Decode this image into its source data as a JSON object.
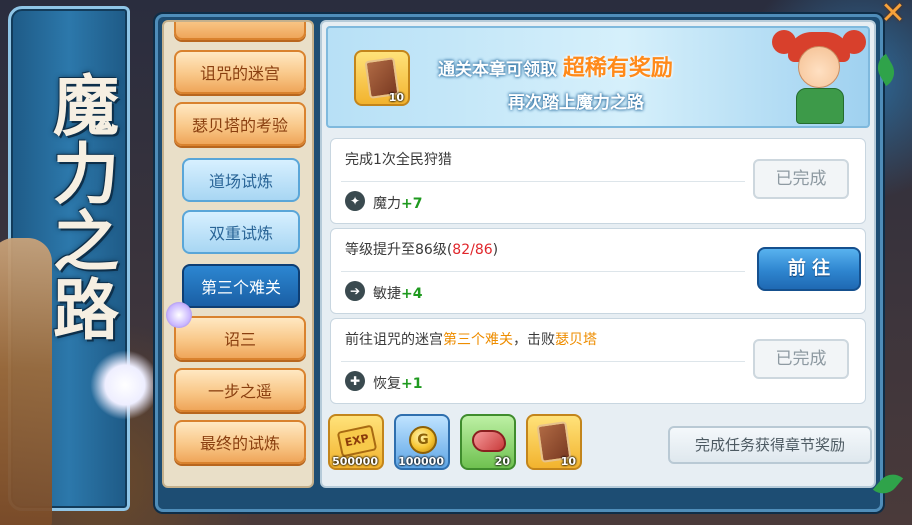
{
  "banner": {
    "title": "魔力之路"
  },
  "window": {
    "close_glyph": "✕",
    "close_icon": "close-icon"
  },
  "nav": {
    "items": [
      {
        "label": "诅咒的迷宫",
        "style": "orange"
      },
      {
        "label": "瑟贝塔的考验",
        "style": "orange"
      },
      {
        "label": "道场试炼",
        "style": "blue"
      },
      {
        "label": "双重试炼",
        "style": "blue"
      },
      {
        "label": "第三个难关",
        "style": "blue-active"
      },
      {
        "label": "诏三",
        "style": "orange"
      },
      {
        "label": "一步之遥",
        "style": "orange"
      },
      {
        "label": "最终的试炼",
        "style": "orange"
      }
    ]
  },
  "promo": {
    "line1_prefix": "通关本章可领取",
    "line1_highlight": "超稀有奖励",
    "line2": "再次踏上魔力之路",
    "item": {
      "icon": "card-icon",
      "qty": "10"
    }
  },
  "tasks": [
    {
      "title": "完成1次全民狩猎",
      "reward_icon": "magic-icon",
      "reward_label": "魔力",
      "reward_value": "+7",
      "button": "已完成",
      "button_state": "done"
    },
    {
      "title_prefix": "等级提升至86级(",
      "title_progress_current": "82",
      "title_progress_sep": "/",
      "title_progress_total": "86",
      "title_suffix": ")",
      "reward_icon": "agility-icon",
      "reward_label": "敏捷",
      "reward_value": "+4",
      "button": "前 往",
      "button_state": "go"
    },
    {
      "title_prefix": "前往诅咒的迷宫",
      "title_hl1": "第三个难关",
      "title_mid": "，击败",
      "title_hl2": "瑟贝塔",
      "reward_icon": "recovery-icon",
      "reward_label": "恢复",
      "reward_value": "+1",
      "button": "已完成",
      "button_state": "done"
    }
  ],
  "rewards": [
    {
      "icon": "exp-icon",
      "glyph": "EXP",
      "qty": "500000"
    },
    {
      "icon": "coin-icon",
      "glyph": "G",
      "qty": "100000"
    },
    {
      "icon": "meat-icon",
      "glyph": "",
      "qty": "20"
    },
    {
      "icon": "card-icon",
      "glyph": "",
      "qty": "10"
    }
  ],
  "chapter_button": "完成任务获得章节奖励",
  "colors": {
    "accent_blue": "#2e85cf",
    "highlight_orange": "#ee8d00",
    "stat_green": "#1f9a1f",
    "progress_red": "#e0262b"
  }
}
